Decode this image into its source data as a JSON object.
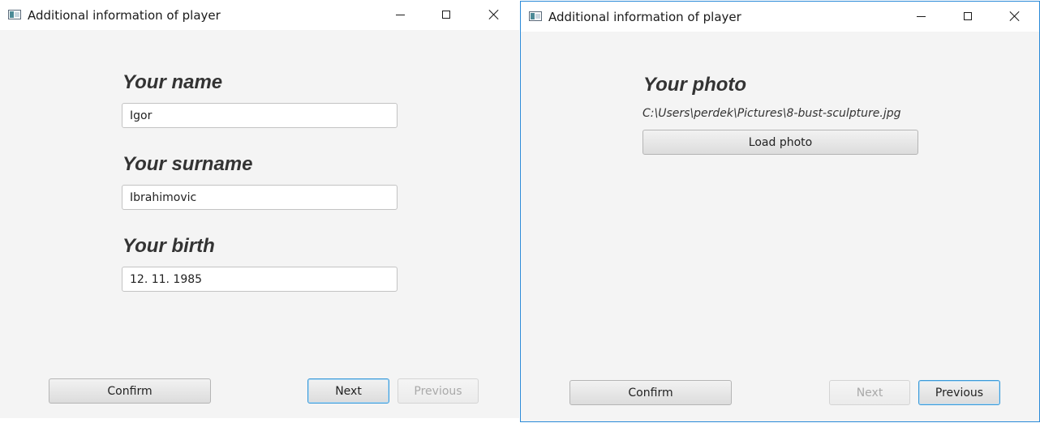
{
  "left_window": {
    "title": "Additional information of player",
    "name_heading": "Your name",
    "name_value": "Igor",
    "surname_heading": "Your surname",
    "surname_value": "Ibrahimovic",
    "birth_heading": "Your birth",
    "birth_value": "12. 11. 1985",
    "confirm_label": "Confirm",
    "next_label": "Next",
    "previous_label": "Previous"
  },
  "right_window": {
    "title": "Additional information of player",
    "photo_heading": "Your photo",
    "photo_path": "C:\\Users\\perdek\\Pictures\\8-bust-sculpture.jpg",
    "load_photo_label": "Load photo",
    "confirm_label": "Confirm",
    "next_label": "Next",
    "previous_label": "Previous"
  },
  "icons": {
    "app": "app-icon",
    "minimize": "minimize-icon",
    "maximize": "maximize-icon",
    "close": "close-icon"
  },
  "colors": {
    "focus_border": "#3a9ad9",
    "active_window_border": "#2b8ad8",
    "window_background": "#f4f4f4"
  }
}
